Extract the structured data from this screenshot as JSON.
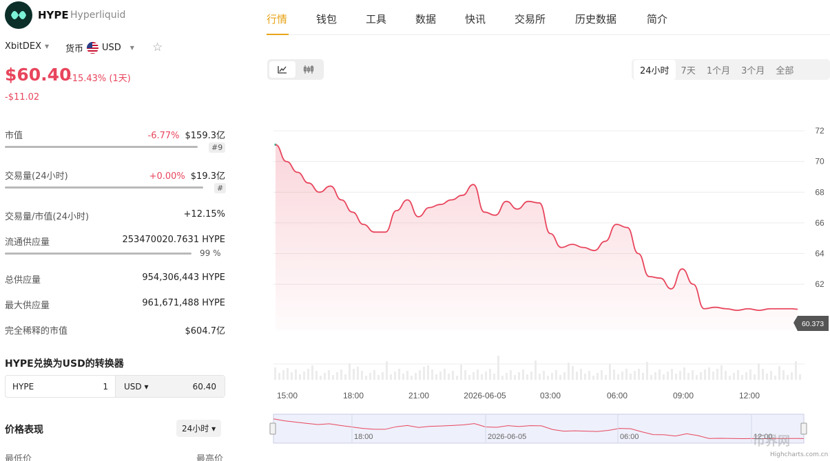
{
  "asset": {
    "symbol": "HYPE",
    "name": "Hyperliquid"
  },
  "exchange": "XbitDEX",
  "currency_label": "货币",
  "currency": "USD",
  "price": "$60.40",
  "price_change_pct": "-15.43% (1天)",
  "price_change_abs": "-$11.02",
  "stats": [
    {
      "label": "市值",
      "change": "-6.77%",
      "value": "$159.3亿",
      "rank": "#9"
    },
    {
      "label": "交易量(24小时)",
      "change": "+0.00%",
      "value": "$19.3亿",
      "rank": "#"
    },
    {
      "label": "交易量/市值(24小时)",
      "value": "+12.15%"
    },
    {
      "label": "流通供应量",
      "value": "253470020.7631 HYPE",
      "percent": "99 %"
    },
    {
      "label": "总供应量",
      "value": "954,306,443 HYPE"
    },
    {
      "label": "最大供应量",
      "value": "961,671,488 HYPE"
    },
    {
      "label": "完全稀释的市值",
      "value": "$604.7亿"
    }
  ],
  "converter": {
    "title": "HYPE兑换为USD的转换器",
    "from": "HYPE",
    "amount": "1",
    "to": "USD ▾",
    "result": "60.40"
  },
  "performance": {
    "title": "价格表现",
    "period": "24小时 ▾",
    "low_label": "最低价",
    "high_label": "最高价"
  },
  "tabs": [
    "行情",
    "钱包",
    "工具",
    "数据",
    "快讯",
    "交易所",
    "历史数据",
    "简介"
  ],
  "ranges": [
    "24小时",
    "7天",
    "1个月",
    "3个月",
    "全部"
  ],
  "colors": {
    "accent": "#e8a317",
    "negative": "#e8455c",
    "line": "#e8455c"
  },
  "chart_data": {
    "type": "area",
    "yticks": [
      62,
      64,
      66,
      68,
      70,
      72
    ],
    "ylim": [
      59,
      72.5
    ],
    "xticks": [
      "15:00",
      "18:00",
      "21:00",
      "2026-06-05",
      "03:00",
      "06:00",
      "09:00",
      "12:00"
    ],
    "navigator_ticks": [
      "18:00",
      "2026-06-05",
      "06:00",
      "12:00"
    ],
    "last_value": "60.373",
    "x": [
      0,
      0.5,
      1,
      1.5,
      2,
      2.5,
      3,
      3.5,
      4,
      4.5,
      5,
      5.5,
      6,
      6.5,
      7,
      7.5,
      8,
      8.5,
      9,
      9.5,
      10,
      10.5,
      11,
      11.5,
      12,
      12.5,
      13,
      13.5,
      14,
      14.5,
      15,
      15.5,
      16,
      16.5,
      17,
      17.5,
      18,
      18.5,
      19,
      19.5,
      20,
      20.5,
      21,
      21.5,
      22,
      22.5,
      23,
      23.5,
      23.75
    ],
    "values": [
      71.1,
      70,
      69.3,
      68.6,
      68,
      68.4,
      67.5,
      66.7,
      65.9,
      65.4,
      65.4,
      66.8,
      67.5,
      66.4,
      67,
      67.2,
      67.5,
      67.8,
      68.5,
      66.7,
      66.5,
      67.4,
      66.9,
      67.4,
      67.3,
      65.3,
      64.4,
      64.6,
      64.4,
      64.2,
      64.8,
      65.9,
      65.7,
      64,
      62.5,
      62.4,
      61.7,
      63,
      62,
      60.4,
      60.5,
      60.4,
      60.3,
      60.4,
      60.3,
      60.4,
      60.4,
      60.4,
      60.373
    ]
  },
  "footer": {
    "credit": "Highcharts.com.cn",
    "watermark": "币界网"
  }
}
